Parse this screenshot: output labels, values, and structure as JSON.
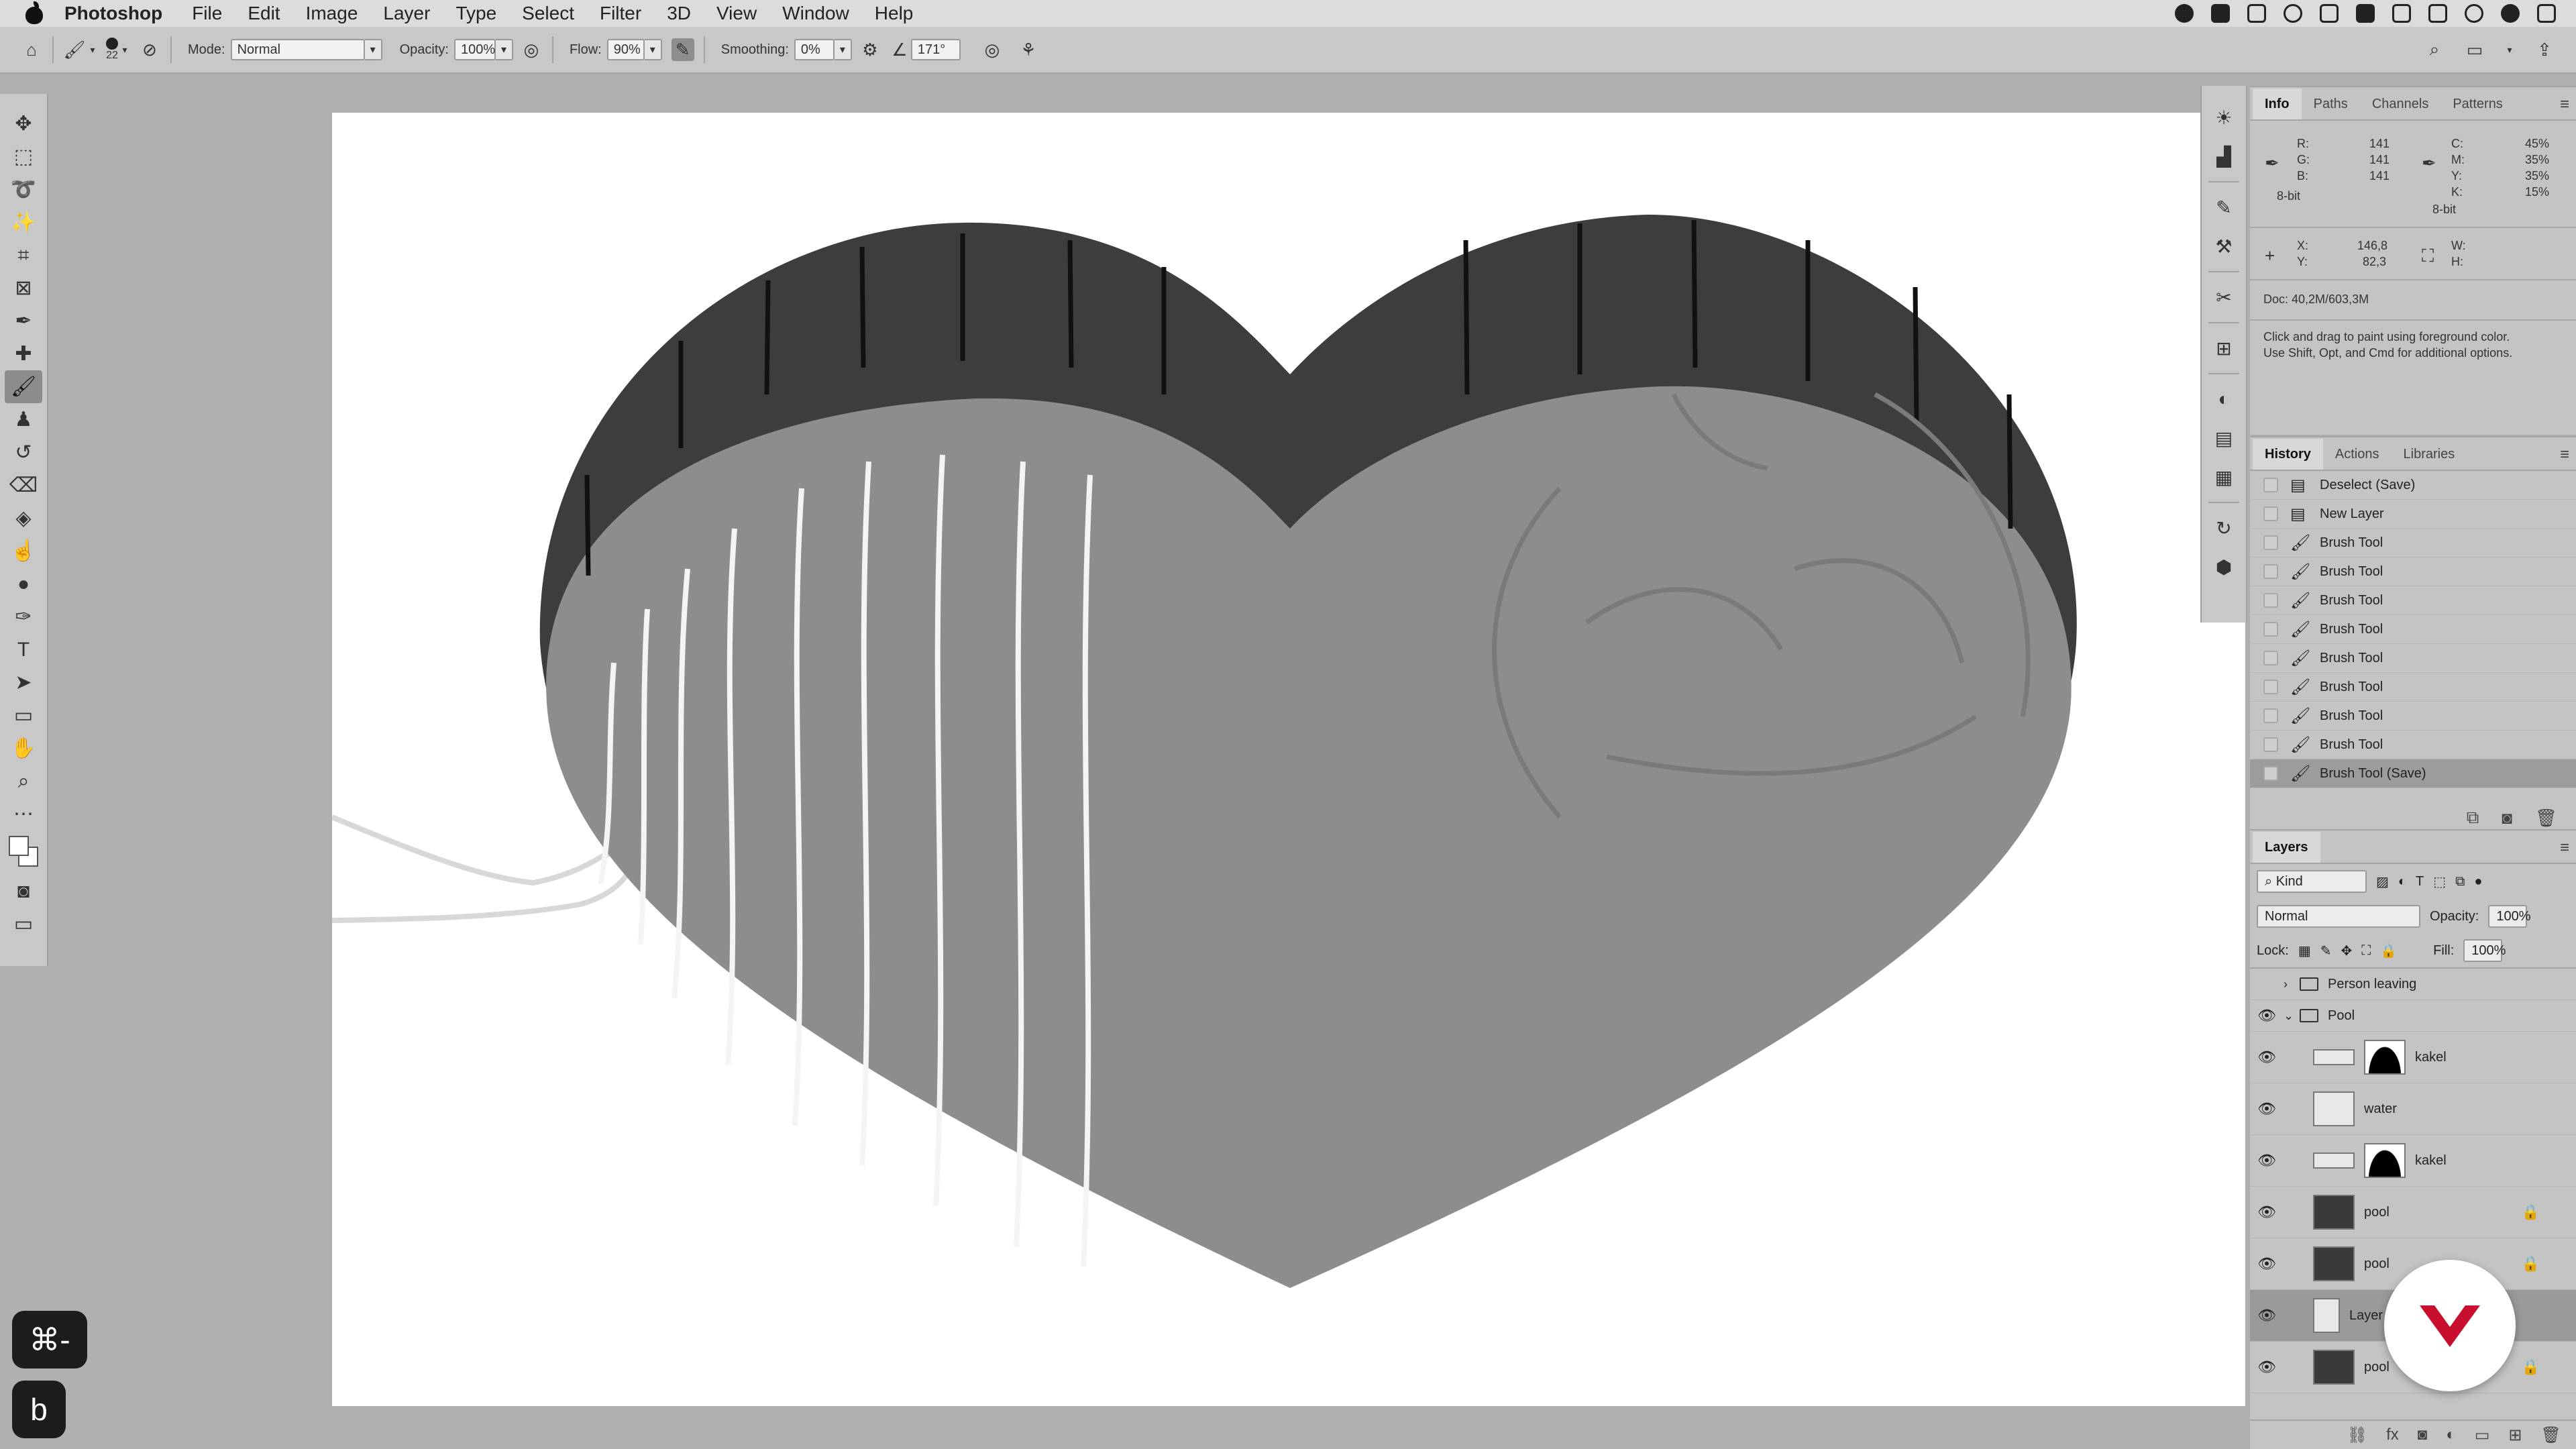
{
  "menubar": {
    "app_name": "Photoshop",
    "items": [
      "File",
      "Edit",
      "Image",
      "Layer",
      "Type",
      "Select",
      "Filter",
      "3D",
      "View",
      "Window",
      "Help"
    ]
  },
  "options": {
    "brush_size": "22",
    "mode_label": "Mode:",
    "mode_value": "Normal",
    "opacity_label": "Opacity:",
    "opacity_value": "100%",
    "flow_label": "Flow:",
    "flow_value": "90%",
    "smoothing_label": "Smoothing:",
    "smoothing_value": "0%",
    "angle_value": "171°"
  },
  "info": {
    "tabs": [
      "Info",
      "Paths",
      "Channels",
      "Patterns"
    ],
    "r_label": "R:",
    "r": "141",
    "g_label": "G:",
    "g": "141",
    "b_label": "B:",
    "b": "141",
    "bit_left": "8-bit",
    "c_label": "C:",
    "c": "45%",
    "m_label": "M:",
    "m": "35%",
    "y_label": "Y:",
    "y": "35%",
    "k_label": "K:",
    "k": "15%",
    "bit_right": "8-bit",
    "x_label": "X:",
    "x": "146,8",
    "yy_label": "Y:",
    "yy": "82,3",
    "w_label": "W:",
    "h_label": "H:",
    "doc": "Doc: 40,2M/603,3M",
    "hint1": "Click and drag to paint using foreground color.",
    "hint2": "Use Shift, Opt, and Cmd for additional options."
  },
  "history": {
    "tabs": [
      "History",
      "Actions",
      "Libraries"
    ],
    "items": [
      {
        "label": "Deselect (Save)",
        "icon": "document-icon"
      },
      {
        "label": "New Layer",
        "icon": "document-icon"
      },
      {
        "label": "Brush Tool",
        "icon": "brush-icon"
      },
      {
        "label": "Brush Tool",
        "icon": "brush-icon"
      },
      {
        "label": "Brush Tool",
        "icon": "brush-icon"
      },
      {
        "label": "Brush Tool",
        "icon": "brush-icon"
      },
      {
        "label": "Brush Tool",
        "icon": "brush-icon"
      },
      {
        "label": "Brush Tool",
        "icon": "brush-icon"
      },
      {
        "label": "Brush Tool",
        "icon": "brush-icon"
      },
      {
        "label": "Brush Tool",
        "icon": "brush-icon"
      },
      {
        "label": "Brush Tool (Save)",
        "icon": "brush-icon"
      }
    ]
  },
  "layers": {
    "tab": "Layers",
    "kind_label": "Kind",
    "blend_mode": "Normal",
    "opacity_label": "Opacity:",
    "opacity_value": "100%",
    "lock_label": "Lock:",
    "fill_label": "Fill:",
    "fill_value": "100%",
    "rows": [
      {
        "name": "Person leaving",
        "type": "group",
        "visible": false,
        "collapsed": true
      },
      {
        "name": "Pool",
        "type": "group",
        "visible": true,
        "collapsed": false
      },
      {
        "name": "kakel",
        "type": "masked",
        "visible": true
      },
      {
        "name": "water",
        "type": "layer",
        "visible": true
      },
      {
        "name": "kakel",
        "type": "masked",
        "visible": true
      },
      {
        "name": "pool",
        "type": "layer",
        "visible": true,
        "locked": true
      },
      {
        "name": "pool",
        "type": "layer",
        "visible": true,
        "locked": true
      },
      {
        "name": "Layer",
        "type": "layer",
        "visible": true,
        "selected": true
      },
      {
        "name": "pool",
        "type": "layer",
        "visible": true,
        "locked": true
      }
    ]
  },
  "overlays": {
    "keycap_shortcut": "⌘-",
    "keycap_letter": "b"
  },
  "colors": {
    "heart_face": "#8d8d8d",
    "heart_rim": "#3d3d3d",
    "accent_red": "#c8102e"
  }
}
